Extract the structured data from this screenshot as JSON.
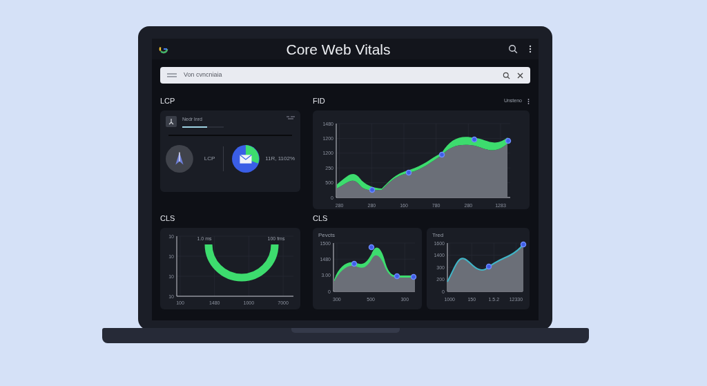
{
  "header": {
    "title": "Core Web Vitals"
  },
  "search": {
    "placeholder": "Von cvncniaia"
  },
  "lcp": {
    "heading": "LCP",
    "item_label": "Nedr lnrd",
    "level": 0.6,
    "metric_label": "LCP",
    "metric_value": "11R, 1102%"
  },
  "fid": {
    "heading": "FID",
    "menu_label": "Unsteno",
    "yticks": [
      "1480",
      "1200",
      "1200",
      "250",
      "500",
      "0"
    ],
    "xticks": [
      "280",
      "280",
      "160",
      "780",
      "280",
      "1283"
    ]
  },
  "cls_left": {
    "heading": "CLS",
    "yticks": [
      "10",
      "10",
      "10",
      "10"
    ],
    "labels": [
      "1.0 ms",
      "100 fms"
    ],
    "xticks": [
      "100",
      "1480",
      "1000",
      "7000"
    ]
  },
  "cls_right": {
    "heading": "CLS",
    "charts": [
      {
        "title": "Pevcts",
        "yticks": [
          "1500",
          "1480",
          "3.00",
          "0"
        ],
        "xticks": [
          "300",
          "500",
          "300"
        ],
        "color": "#3ddc6e"
      },
      {
        "title": "Tred",
        "yticks": [
          "1600",
          "1400",
          "300",
          "200",
          "0"
        ],
        "xticks": [
          "1000",
          "150",
          "1.5.2",
          "12330"
        ],
        "color": "#3fb6c8"
      }
    ]
  }
}
